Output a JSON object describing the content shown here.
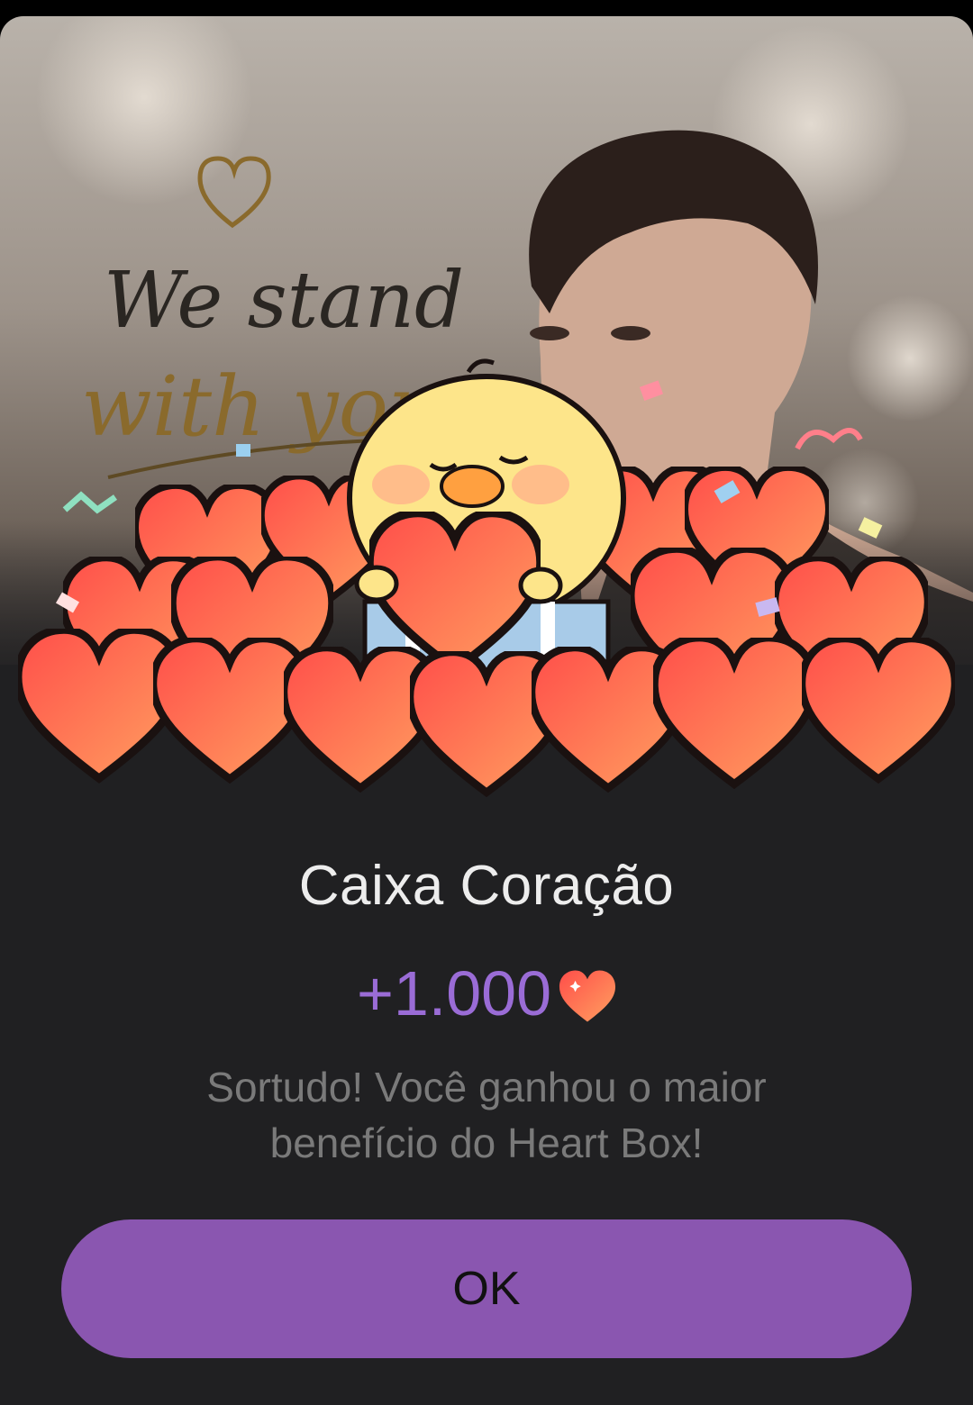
{
  "dialog": {
    "banner_text_line1": "We stand",
    "banner_text_line2": "with you",
    "title": "Caixa Coração",
    "reward_amount": "+1.000",
    "reward_icon": "heart-icon",
    "message": "Sortudo! Você ganhou o maior benefício do Heart Box!",
    "ok_label": "OK"
  },
  "colors": {
    "background": "#202022",
    "accent_purple": "#8a56b0",
    "reward_text": "#9a6cd6",
    "heart_red": "#ff5a4e",
    "heart_orange": "#ff9a5c"
  }
}
